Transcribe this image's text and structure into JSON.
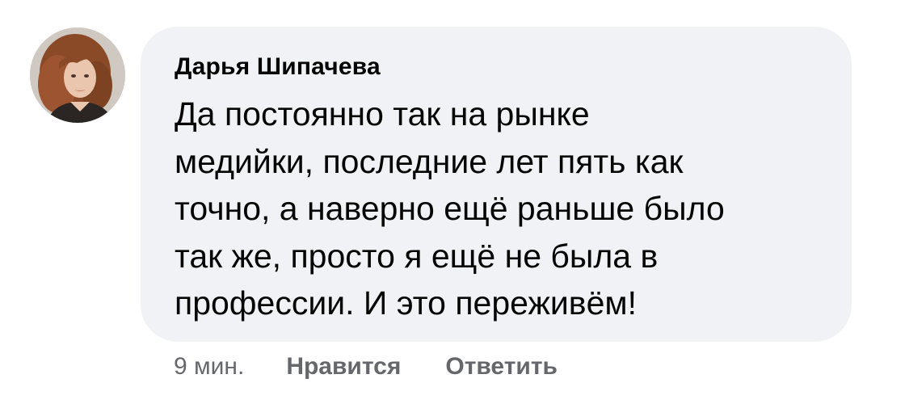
{
  "comment": {
    "avatar_icon": "user-photo-avatar",
    "author": "Дарья Шипачева",
    "text": "Да постоянно так на рынке\nмедийки, последние лет пять как\nточно, а наверно ещё раньше было\nтак же, просто я ещё не была в\nпрофессии. И это переживём!",
    "timestamp": "9 мин.",
    "like_label": "Нравится",
    "reply_label": "Ответить"
  },
  "colors": {
    "bubble_background": "#f0f2f5",
    "text": "#050505",
    "secondary_text": "#65676b"
  }
}
